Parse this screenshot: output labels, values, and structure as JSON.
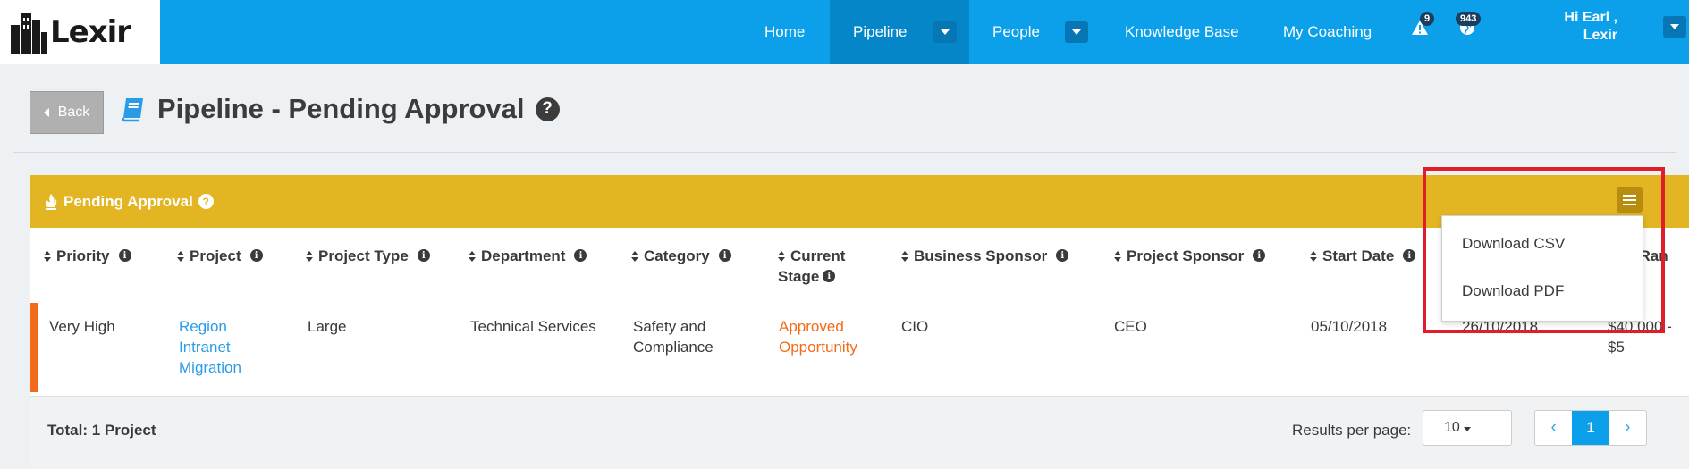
{
  "logo": {
    "text": "Lexir"
  },
  "nav": {
    "home": "Home",
    "pipeline": "Pipeline",
    "people": "People",
    "knowledge_base": "Knowledge Base",
    "my_coaching": "My Coaching",
    "alerts_count": "9",
    "notifications_count": "943",
    "user_greeting_line1": "Hi Earl ,",
    "user_greeting_line2": "Lexir"
  },
  "page": {
    "back_label": "Back",
    "title": "Pipeline - Pending Approval",
    "help": "?"
  },
  "panel": {
    "title": "Pending Approval",
    "help": "?"
  },
  "table": {
    "headers": [
      {
        "line1": "Priority",
        "line2": ""
      },
      {
        "line1": "Project",
        "line2": ""
      },
      {
        "line1": "Project Type",
        "line2": ""
      },
      {
        "line1": "Department",
        "line2": ""
      },
      {
        "line1": "Category",
        "line2": ""
      },
      {
        "line1": "Current",
        "line2": "Stage"
      },
      {
        "line1": "Business Sponsor",
        "line2": ""
      },
      {
        "line1": "Project Sponsor",
        "line2": ""
      },
      {
        "line1": "Start Date",
        "line2": ""
      },
      {
        "line1": "Cost Ran",
        "line2": ""
      }
    ],
    "rows": [
      {
        "priority": "Very High",
        "project_line1": "Region",
        "project_line2": "Intranet",
        "project_line3": "Migration",
        "project_type": "Large",
        "department": "Technical Services",
        "category_line1": "Safety and",
        "category_line2": "Compliance",
        "stage_line1": "Approved",
        "stage_line2": "Opportunity",
        "business_sponsor": "CIO",
        "project_sponsor": "CEO",
        "start_date": "05/10/2018",
        "end_date": "26/10/2018",
        "cost_range": "$40,000 - $5"
      }
    ]
  },
  "footer": {
    "total": "Total: 1 Project",
    "results_per_page_label": "Results per page:",
    "results_per_page_value": "10",
    "current_page": "1",
    "prev": "‹",
    "next": "›"
  },
  "dropdown": {
    "download_csv": "Download CSV",
    "download_pdf": "Download PDF"
  },
  "colors": {
    "nav_bg": "#0ba0e9",
    "nav_active": "#0586c8",
    "panel_header": "#e4b523",
    "priority_bar": "#f26b1a",
    "link": "#2c9be6",
    "highlight_box": "#e01d2a"
  }
}
